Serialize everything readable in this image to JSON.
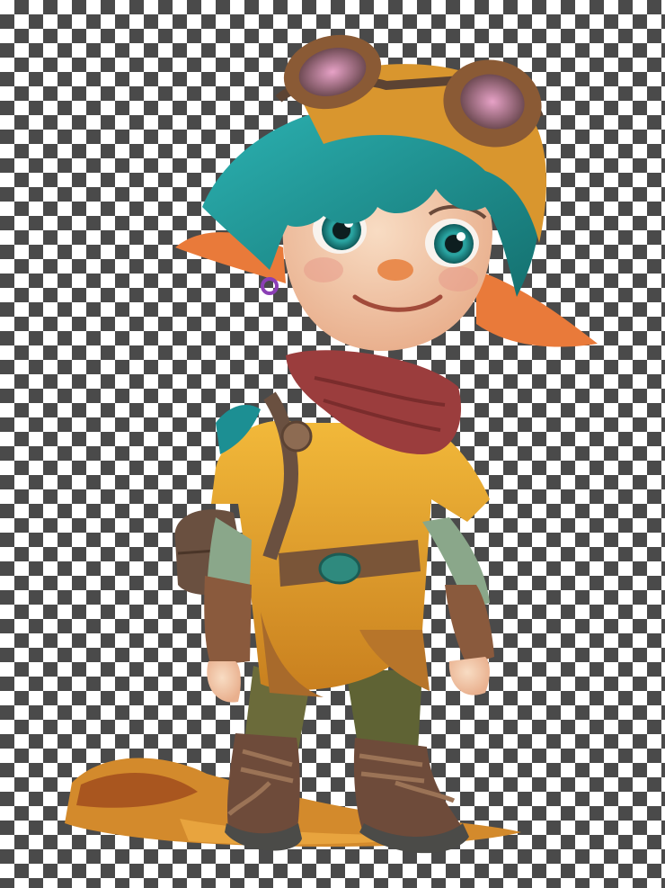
{
  "image": {
    "background": "transparency-checkerboard",
    "subject": "goblin-character",
    "colors": {
      "hair": "#1c8f93",
      "skin": "#f2c7a6",
      "ears": "#e97a3a",
      "scarf": "#9b3d3d",
      "tunic": "#e2a12c",
      "goggles": "#8a5a35",
      "pants": "#6b6b3a",
      "boots": "#6e4b3a",
      "checker_dark": "#4a4a4a",
      "checker_light": "#ffffff"
    }
  }
}
